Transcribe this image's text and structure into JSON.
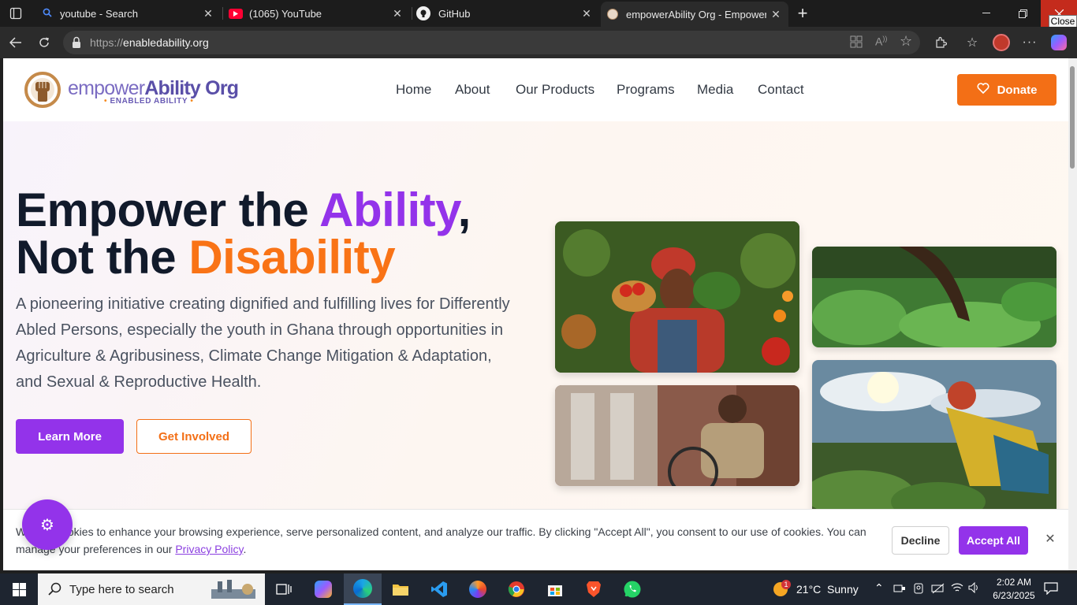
{
  "browser": {
    "tabs": [
      {
        "title": "youtube - Search",
        "icon": "search-icon",
        "active": false
      },
      {
        "title": "(1065) YouTube",
        "icon": "youtube-icon",
        "active": false
      },
      {
        "title": "GitHub",
        "icon": "github-icon",
        "active": false
      },
      {
        "title": "empowerAbility Org - Empower the Ability",
        "icon": "site-favicon",
        "active": true
      }
    ],
    "close_tooltip": "Close",
    "url_protocol": "https://",
    "url_host": "enabledability.org"
  },
  "site": {
    "logo": {
      "name_part1": "empower",
      "name_part2": "Ability Org",
      "tagline": "ENABLED ABILITY"
    },
    "nav": [
      "Home",
      "About",
      "Our Products",
      "Programs",
      "Media",
      "Contact"
    ],
    "donate_label": "Donate",
    "hero": {
      "title_line1_a": "Empower the ",
      "title_line1_b": "Ability",
      "title_line1_c": ",",
      "title_line2_a": "Not the ",
      "title_line2_b": "Disability",
      "description": "A pioneering initiative creating dignified and fulfilling lives for Differently Abled Persons, especially the youth in Ghana through opportunities in Agriculture & Agribusiness, Climate Change Mitigation & Adaptation, and Sexual & Reproductive Health.",
      "learn_more": "Learn More",
      "get_involved": "Get Involved"
    },
    "cookie": {
      "text_before": "We use cookies to enhance your browsing experience, serve personalized content, and analyze our traffic. By clicking \"Accept All\", you consent to our use of cookies. You can manage your preferences in our ",
      "link": "Privacy Policy",
      "text_after": ".",
      "decline": "Decline",
      "accept": "Accept All"
    }
  },
  "taskbar": {
    "search_placeholder": "Type here to search",
    "weather": "21°C  Sunny",
    "weather_badge": "1",
    "time": "2:02 AM",
    "date": "6/23/2025"
  },
  "colors": {
    "brand_purple": "#9333ea",
    "brand_orange": "#f97316"
  }
}
